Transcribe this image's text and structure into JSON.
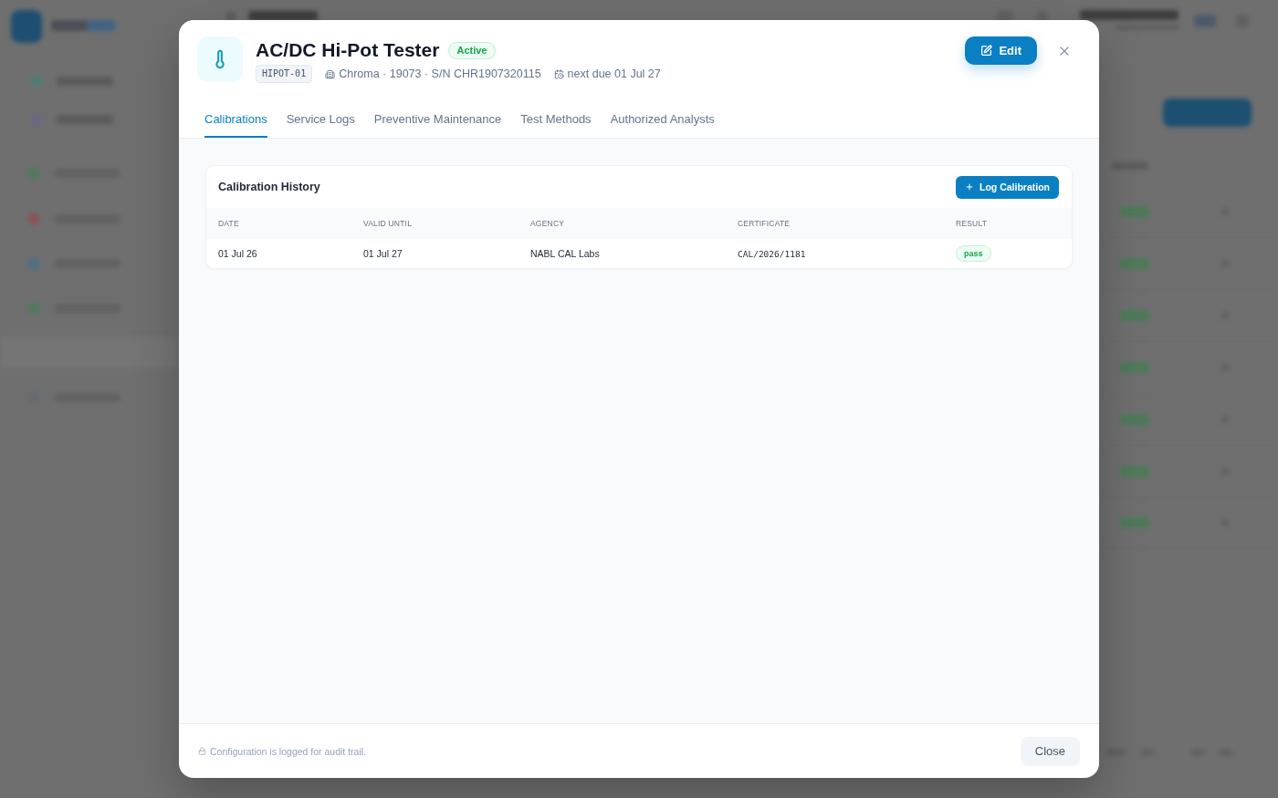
{
  "dialog": {
    "title": "AC/DC Hi-Pot Tester",
    "status": {
      "label": "Active",
      "kind": "active"
    },
    "asset_code": "HIPOT-01",
    "maker_line": "Chroma · 19073 · S/N CHR1907320115",
    "next_due": "next due 01 Jul 27",
    "edit_button": "Edit",
    "tabs": [
      {
        "label": "Calibrations",
        "selected": true
      },
      {
        "label": "Service Logs",
        "selected": false
      },
      {
        "label": "Preventive Maintenance",
        "selected": false
      },
      {
        "label": "Test Methods",
        "selected": false
      },
      {
        "label": "Authorized Analysts",
        "selected": false
      }
    ],
    "panel": {
      "title": "Calibration History",
      "action_button": "Log Calibration",
      "columns": [
        "DATE",
        "VALID UNTIL",
        "AGENCY",
        "CERTIFICATE",
        "RESULT"
      ],
      "rows": [
        {
          "date": "01 Jul 26",
          "valid_until": "01 Jul 27",
          "agency": "NABL CAL Labs",
          "certificate": "CAL/2026/1181",
          "result": {
            "label": "pass",
            "kind": "pass"
          }
        }
      ]
    },
    "footer": {
      "note": "Configuration is logged for audit trail.",
      "close_button": "Close"
    }
  }
}
